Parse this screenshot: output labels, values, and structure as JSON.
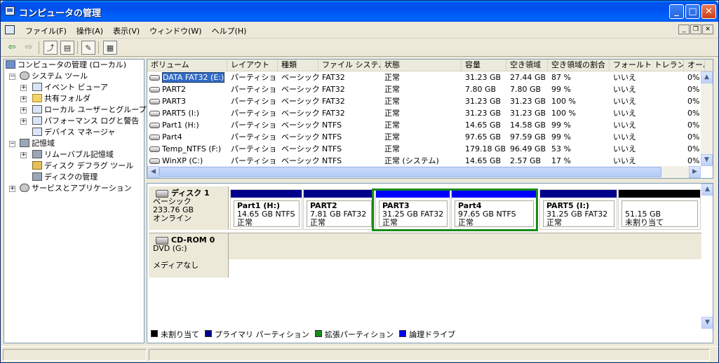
{
  "window": {
    "title": "コンピュータの管理"
  },
  "menubar": {
    "items": [
      "ファイル(F)",
      "操作(A)",
      "表示(V)",
      "ウィンドウ(W)",
      "ヘルプ(H)"
    ]
  },
  "titlebar_buttons": {
    "minimize": "_",
    "maximize": "□",
    "close": "✕"
  },
  "tree": {
    "root": "コンピュータの管理 (ローカル)",
    "system_tools": "システム ツール",
    "event_viewer": "イベント ビューア",
    "shared_folders": "共有フォルダ",
    "local_users": "ローカル ユーザーとグループ",
    "perf_logs": "パフォーマンス ログと警告",
    "device_manager": "デバイス マネージャ",
    "storage": "記憶域",
    "removable": "リムーバブル記憶域",
    "defrag": "ディスク デフラグ ツール",
    "disk_mgmt": "ディスクの管理",
    "services": "サービスとアプリケーション"
  },
  "list": {
    "headers": [
      "ボリューム",
      "レイアウト",
      "種類",
      "ファイル システム",
      "状態",
      "容量",
      "空き領域",
      "空き領域の割合",
      "フォールト トレランス",
      "オーバ"
    ],
    "rows": [
      [
        "DATA FAT32 (E:)",
        "パーティション",
        "ベーシック",
        "FAT32",
        "正常",
        "31.23 GB",
        "27.44 GB",
        "87 %",
        "いいえ",
        "0%"
      ],
      [
        "PART2",
        "パーティション",
        "ベーシック",
        "FAT32",
        "正常",
        "7.80 GB",
        "7.80 GB",
        "99 %",
        "いいえ",
        "0%"
      ],
      [
        "PART3",
        "パーティション",
        "ベーシック",
        "FAT32",
        "正常",
        "31.23 GB",
        "31.23 GB",
        "100 %",
        "いいえ",
        "0%"
      ],
      [
        "PART5 (I:)",
        "パーティション",
        "ベーシック",
        "FAT32",
        "正常",
        "31.23 GB",
        "31.23 GB",
        "100 %",
        "いいえ",
        "0%"
      ],
      [
        "Part1 (H:)",
        "パーティション",
        "ベーシック",
        "NTFS",
        "正常",
        "14.65 GB",
        "14.58 GB",
        "99 %",
        "いいえ",
        "0%"
      ],
      [
        "Part4",
        "パーティション",
        "ベーシック",
        "NTFS",
        "正常",
        "97.65 GB",
        "97.59 GB",
        "99 %",
        "いいえ",
        "0%"
      ],
      [
        "Temp_NTFS (F:)",
        "パーティション",
        "ベーシック",
        "NTFS",
        "正常",
        "179.18 GB",
        "96.49 GB",
        "53 %",
        "いいえ",
        "0%"
      ],
      [
        "WinXP (C:)",
        "パーティション",
        "ベーシック",
        "NTFS",
        "正常 (システム)",
        "14.65 GB",
        "2.57 GB",
        "17 %",
        "いいえ",
        "0%"
      ]
    ]
  },
  "disk1": {
    "name": "ディスク 1",
    "type": "ベーシック",
    "size": "233.76 GB",
    "status": "オンライン",
    "partitions": [
      {
        "name": "Part1 (H:)",
        "size": "14.65 GB NTFS",
        "state": "正常",
        "bar_color": "#00008b"
      },
      {
        "name": "PART2",
        "size": "7.81 GB FAT32",
        "state": "正常",
        "bar_color": "#00008b"
      },
      {
        "name": "PART3",
        "size": "31.25 GB FAT32",
        "state": "正常",
        "bar_color": "#0000ff"
      },
      {
        "name": "Part4",
        "size": "97.65 GB NTFS",
        "state": "正常",
        "bar_color": "#0000ff"
      },
      {
        "name": "PART5 (I:)",
        "size": "31.25 GB FAT32",
        "state": "正常",
        "bar_color": "#00008b"
      },
      {
        "name": "",
        "size": "51.15 GB",
        "state": "未割り当て",
        "bar_color": "#000000"
      }
    ]
  },
  "cdrom": {
    "name": "CD-ROM 0",
    "drive": "DVD (G:)",
    "media": "メディアなし"
  },
  "legend": [
    {
      "label": "未割り当て",
      "color": "#000000"
    },
    {
      "label": "プライマリ パーティション",
      "color": "#00008b"
    },
    {
      "label": "拡張パーティション",
      "color": "#1a8a1a"
    },
    {
      "label": "論理ドライブ",
      "color": "#0000ff"
    }
  ]
}
